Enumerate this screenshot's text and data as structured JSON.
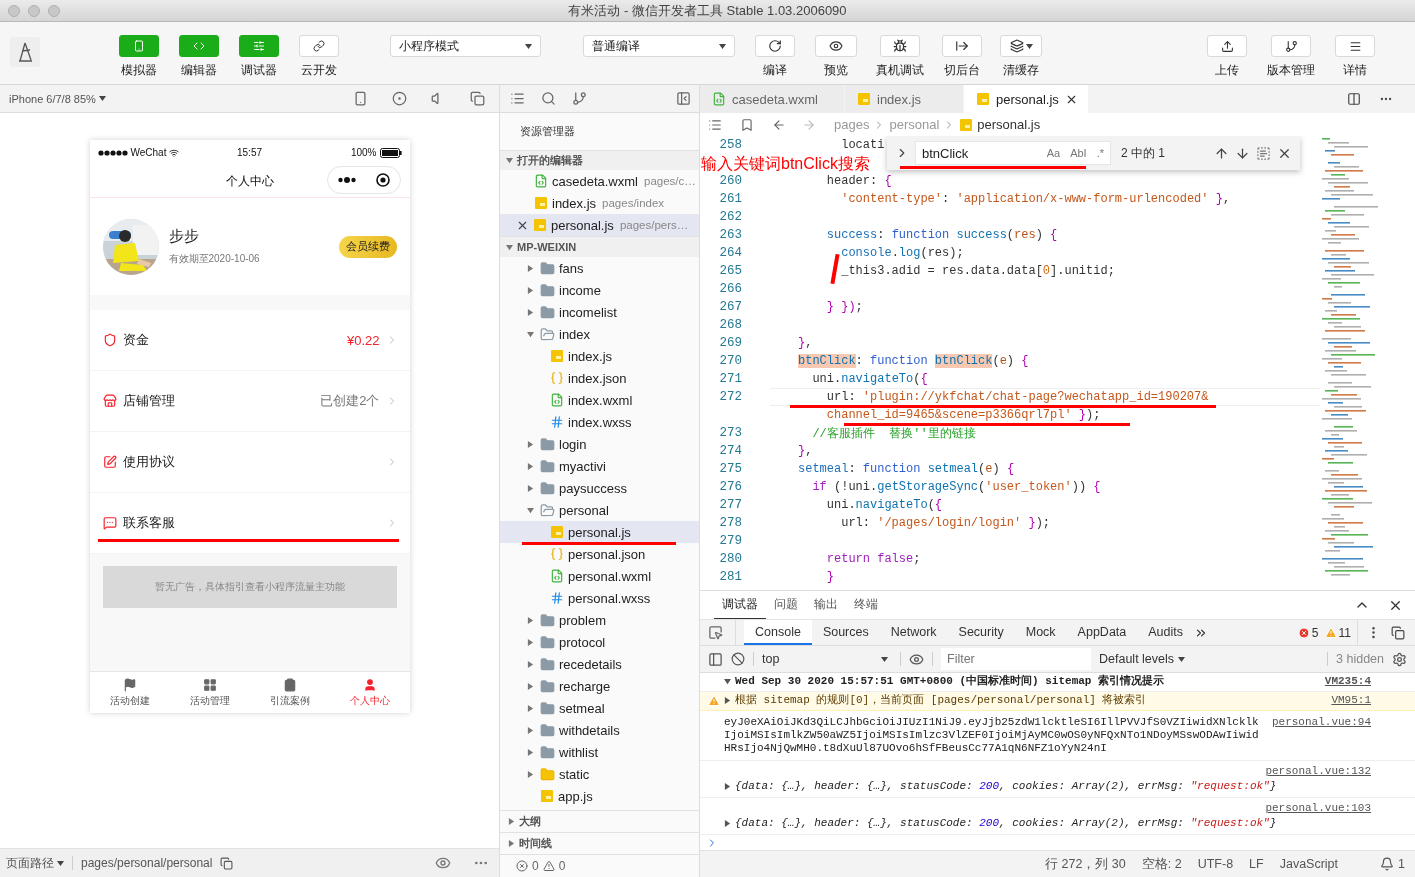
{
  "window": {
    "title": "有米活动 - 微信开发者工具 Stable 1.03.2006090"
  },
  "toolbar": {
    "view_buttons": [
      {
        "label": "模拟器",
        "on": true
      },
      {
        "label": "编辑器",
        "on": true
      },
      {
        "label": "调试器",
        "on": true
      },
      {
        "label": "云开发",
        "on": false
      }
    ],
    "mode_select": {
      "value": "小程序模式"
    },
    "compile_select": {
      "value": "普通编译"
    },
    "compile_buttons": [
      {
        "label": "编译"
      },
      {
        "label": "预览"
      }
    ],
    "tools": [
      {
        "label": "真机调试"
      },
      {
        "label": "切后台"
      },
      {
        "label": "清缓存"
      }
    ],
    "right_buttons": [
      {
        "label": "上传"
      },
      {
        "label": "版本管理"
      },
      {
        "label": "详情"
      }
    ]
  },
  "simulator": {
    "device": "iPhone 6/7/8 85%",
    "phone": {
      "carrier": "WeChat",
      "time": "15:57",
      "battery": "100%",
      "title": "个人中心",
      "user": {
        "name": "步步",
        "expiry": "有效期至2020-10-06",
        "badge": "会员续费"
      },
      "rows": [
        {
          "label": "资金",
          "value": "¥0.22",
          "emphasis": true,
          "marked": false
        },
        {
          "label": "店铺管理",
          "value": "已创建2个",
          "emphasis": false,
          "marked": false
        },
        {
          "label": "使用协议",
          "marked": false
        },
        {
          "label": "联系客服",
          "marked": true
        }
      ],
      "ad": "暂无广告，具体指引查看小程序流量主功能",
      "tabs": [
        {
          "label": "活动创建",
          "selected": false
        },
        {
          "label": "活动管理",
          "selected": false
        },
        {
          "label": "引流案例",
          "selected": false
        },
        {
          "label": "个人中心",
          "selected": true
        }
      ]
    },
    "footer": {
      "label": "页面路径",
      "path": "pages/personal/personal"
    }
  },
  "explorer": {
    "title": "资源管理器",
    "open_editors": {
      "title": "打开的编辑器",
      "expanded": true,
      "items": [
        {
          "name": "casedeta.wxml",
          "path": "pages/c…",
          "kind": "wxml",
          "selected": false
        },
        {
          "name": "index.js",
          "path": "pages/index",
          "kind": "js",
          "selected": false
        },
        {
          "name": "personal.js",
          "path": "pages/pers…",
          "kind": "js",
          "selected": true
        }
      ]
    },
    "project": {
      "title": "MP-WEIXIN",
      "expanded": true,
      "items": [
        {
          "name": "fans",
          "kind": "folder",
          "expanded": false
        },
        {
          "name": "income",
          "kind": "folder",
          "expanded": false
        },
        {
          "name": "incomelist",
          "kind": "folder",
          "expanded": false
        },
        {
          "name": "index",
          "kind": "folder",
          "expanded": true,
          "children": [
            {
              "name": "index.js",
              "kind": "js",
              "selected": false,
              "marked": false
            },
            {
              "name": "index.json",
              "kind": "json",
              "selected": false,
              "marked": false
            },
            {
              "name": "index.wxml",
              "kind": "wxml",
              "selected": false,
              "marked": false
            },
            {
              "name": "index.wxss",
              "kind": "wxss",
              "selected": false,
              "marked": false
            }
          ]
        },
        {
          "name": "login",
          "kind": "folder",
          "expanded": false
        },
        {
          "name": "myactivi",
          "kind": "folder",
          "expanded": false
        },
        {
          "name": "paysuccess",
          "kind": "folder",
          "expanded": false
        },
        {
          "name": "personal",
          "kind": "folder",
          "expanded": true,
          "children": [
            {
              "name": "personal.js",
              "kind": "js",
              "selected": true,
              "marked": true
            },
            {
              "name": "personal.json",
              "kind": "json",
              "selected": false,
              "marked": false
            },
            {
              "name": "personal.wxml",
              "kind": "wxml",
              "selected": false,
              "marked": false
            },
            {
              "name": "personal.wxss",
              "kind": "wxss",
              "selected": false,
              "marked": false
            }
          ]
        },
        {
          "name": "problem",
          "kind": "folder",
          "expanded": false
        },
        {
          "name": "protocol",
          "kind": "folder",
          "expanded": false
        },
        {
          "name": "recedetails",
          "kind": "folder",
          "expanded": false
        },
        {
          "name": "recharge",
          "kind": "folder",
          "expanded": false
        },
        {
          "name": "setmeal",
          "kind": "folder",
          "expanded": false
        },
        {
          "name": "withdetails",
          "kind": "folder",
          "expanded": false
        },
        {
          "name": "withlist",
          "kind": "folder",
          "expanded": false
        },
        {
          "name": "static",
          "kind": "static",
          "expanded": false
        },
        {
          "name": "app.js",
          "kind": "js",
          "selected": false,
          "marked": false
        }
      ]
    },
    "sections": [
      {
        "title": "大纲",
        "expanded": false
      },
      {
        "title": "时间线",
        "expanded": false
      }
    ],
    "problems": {
      "errors": "0",
      "warnings": "0"
    }
  },
  "editor": {
    "tabs": [
      {
        "name": "casedeta.wxml",
        "kind": "wxml",
        "selected": false
      },
      {
        "name": "index.js",
        "kind": "js",
        "selected": false
      },
      {
        "name": "personal.js",
        "kind": "js",
        "selected": true
      }
    ],
    "breadcrumb": [
      "pages",
      "personal",
      "personal.js"
    ],
    "annotation": "输入关键词btnClick搜索",
    "find": {
      "query": "btnClick",
      "marked": true,
      "options": [
        {
          "label": "Aa",
          "on": false
        },
        {
          "label": "AbI",
          "on": false
        },
        {
          "label": ".*",
          "on": false
        }
      ],
      "result": "2 中的 1"
    },
    "lines": [
      {
        "number": "258",
        "tokens": [
          {
            "kind": "plain",
            "text": "      locati"
          }
        ]
      },
      {
        "covered": true
      },
      {
        "number": "260",
        "tokens": [
          {
            "kind": "plain",
            "text": "    header: "
          },
          {
            "kind": "brace",
            "text": "{"
          }
        ]
      },
      {
        "number": "261",
        "tokens": [
          {
            "kind": "string",
            "text": "      'content-type'"
          },
          {
            "kind": "plain",
            "text": ": "
          },
          {
            "kind": "string",
            "text": "'application/x-www-form-urlencoded' "
          },
          {
            "kind": "brace",
            "text": "}"
          },
          {
            "kind": "plain",
            "text": ","
          }
        ]
      },
      {
        "number": "262"
      },
      {
        "number": "263",
        "tokens": [
          {
            "kind": "property",
            "text": "    success"
          },
          {
            "kind": "plain",
            "text": ": "
          },
          {
            "kind": "keyword",
            "text": "function "
          },
          {
            "kind": "function",
            "text": "success"
          },
          {
            "kind": "plain",
            "text": "("
          },
          {
            "kind": "param",
            "text": "res"
          },
          {
            "kind": "plain",
            "text": ") "
          },
          {
            "kind": "brace",
            "text": "{"
          }
        ]
      },
      {
        "number": "264",
        "tokens": [
          {
            "kind": "property",
            "text": "      console"
          },
          {
            "kind": "plain",
            "text": "."
          },
          {
            "kind": "function",
            "text": "log"
          },
          {
            "kind": "plain",
            "text": "(res);"
          }
        ]
      },
      {
        "number": "265",
        "strike": true,
        "tokens": [
          {
            "kind": "plain",
            "text": "      _this3.adid = res.data.data["
          },
          {
            "kind": "number",
            "text": "0"
          },
          {
            "kind": "plain",
            "text": "].unitid;"
          }
        ]
      },
      {
        "number": "266"
      },
      {
        "number": "267",
        "tokens": [
          {
            "kind": "brace",
            "text": "    } })"
          },
          {
            "kind": "plain",
            "text": ";"
          }
        ]
      },
      {
        "number": "268"
      },
      {
        "number": "269",
        "tokens": [
          {
            "kind": "brace",
            "text": "}"
          },
          {
            "kind": "plain",
            "text": ","
          }
        ]
      },
      {
        "number": "270",
        "tokens": [
          {
            "kind": "match",
            "text": "btnClick"
          },
          {
            "kind": "plain",
            "text": ": "
          },
          {
            "kind": "keyword",
            "text": "function "
          },
          {
            "kind": "match",
            "text": "btnClick"
          },
          {
            "kind": "plain",
            "text": "("
          },
          {
            "kind": "param",
            "text": "e"
          },
          {
            "kind": "plain",
            "text": ") "
          },
          {
            "kind": "brace",
            "text": "{"
          }
        ]
      },
      {
        "number": "271",
        "tokens": [
          {
            "kind": "plain",
            "text": "  uni."
          },
          {
            "kind": "function",
            "text": "navigateTo"
          },
          {
            "kind": "plain",
            "text": "("
          },
          {
            "kind": "brace",
            "text": "{"
          }
        ]
      },
      {
        "number": "272",
        "current": true,
        "marked": true,
        "tokens": [
          {
            "kind": "plain",
            "text": "    url: "
          },
          {
            "kind": "string",
            "text": "'plugin://ykfchat/chat-page?wechatapp_id=190207&"
          }
        ]
      },
      {
        "marked": true,
        "tokens": [
          {
            "kind": "string",
            "text": "    channel_id=9465&scene=p3366qrl7pl'"
          },
          {
            "kind": "brace",
            "text": " }"
          },
          {
            "kind": "plain",
            "text": ");"
          }
        ]
      },
      {
        "number": "273",
        "tokens": [
          {
            "kind": "comment",
            "text": "  //客服插件  替换''里的链接"
          }
        ]
      },
      {
        "number": "274",
        "tokens": [
          {
            "kind": "brace",
            "text": "}"
          },
          {
            "kind": "plain",
            "text": ","
          }
        ]
      },
      {
        "number": "275",
        "tokens": [
          {
            "kind": "property",
            "text": "setmeal"
          },
          {
            "kind": "plain",
            "text": ": "
          },
          {
            "kind": "keyword",
            "text": "function "
          },
          {
            "kind": "function",
            "text": "setmeal"
          },
          {
            "kind": "plain",
            "text": "("
          },
          {
            "kind": "param",
            "text": "e"
          },
          {
            "kind": "plain",
            "text": ") "
          },
          {
            "kind": "brace",
            "text": "{"
          }
        ]
      },
      {
        "number": "276",
        "tokens": [
          {
            "kind": "control",
            "text": "  if"
          },
          {
            "kind": "plain",
            "text": " (!uni."
          },
          {
            "kind": "function",
            "text": "getStorageSync"
          },
          {
            "kind": "plain",
            "text": "("
          },
          {
            "kind": "string",
            "text": "'user_token'"
          },
          {
            "kind": "plain",
            "text": ")) "
          },
          {
            "kind": "brace",
            "text": "{"
          }
        ]
      },
      {
        "number": "277",
        "tokens": [
          {
            "kind": "plain",
            "text": "    uni."
          },
          {
            "kind": "function",
            "text": "navigateTo"
          },
          {
            "kind": "plain",
            "text": "("
          },
          {
            "kind": "brace",
            "text": "{"
          }
        ]
      },
      {
        "number": "278",
        "tokens": [
          {
            "kind": "plain",
            "text": "      url: "
          },
          {
            "kind": "string",
            "text": "'/pages/login/login' "
          },
          {
            "kind": "brace",
            "text": "}"
          },
          {
            "kind": "plain",
            "text": ");"
          }
        ]
      },
      {
        "number": "279"
      },
      {
        "number": "280",
        "tokens": [
          {
            "kind": "control",
            "text": "    return false"
          },
          {
            "kind": "plain",
            "text": ";"
          }
        ]
      },
      {
        "number": "281",
        "tokens": [
          {
            "kind": "brace",
            "text": "    }"
          }
        ]
      }
    ]
  },
  "console": {
    "panel_tabs": [
      {
        "label": "调试器",
        "selected": true
      },
      {
        "label": "问题",
        "selected": false
      },
      {
        "label": "输出",
        "selected": false
      },
      {
        "label": "终端",
        "selected": false
      }
    ],
    "devtools_tabs": [
      {
        "label": "Console",
        "selected": true
      },
      {
        "label": "Sources",
        "selected": false
      },
      {
        "label": "Network",
        "selected": false
      },
      {
        "label": "Security",
        "selected": false
      },
      {
        "label": "Mock",
        "selected": false
      },
      {
        "label": "AppData",
        "selected": false
      },
      {
        "label": "Audits",
        "selected": false
      }
    ],
    "errors": "5",
    "warnings": "11",
    "context": "top",
    "filter_placeholder": "Filter",
    "levels": "Default levels",
    "hidden": "3 hidden",
    "messages": [
      {
        "kind": "group",
        "text": "Wed Sep 30 2020 15:57:51 GMT+0800 (中国标准时间) sitemap 索引情况提示",
        "source": "VM235:4"
      },
      {
        "kind": "warning",
        "text": "根据 sitemap 的规则[0]，当前页面 [pages/personal/personal] 将被索引",
        "source": "VM95:1"
      },
      {
        "kind": "log",
        "text": "eyJ0eXAiOiJKd3QiLCJhbGciOiJIUzI1NiJ9.eyJjb25zdW1lcktleSI6IllPVVJfS0VZIiwidXNlcklkIjoiMSIsImlkZW50aWZ5IjoiMSIsImlzc3VlZEF0IjoiMjAyMC0wOS0yNFQxNTo1NDoyMSswODAwIiwidHRsIjo4NjQwMH0.t8dXuUl87UOvo6hSfFBeusCc77A1qN6NFZ1oYyN24nI",
        "source": "personal.vue:94"
      },
      {
        "kind": "object",
        "source": "personal.vue:132",
        "tokens": [
          {
            "kind": "plain",
            "text": "{data: {…}, header: {…}, statusCode: "
          },
          {
            "kind": "number",
            "text": "200"
          },
          {
            "kind": "plain",
            "text": ", cookies: Array(2), errMsg: "
          },
          {
            "kind": "string",
            "text": "\"request:ok\""
          },
          {
            "kind": "plain",
            "text": "}"
          }
        ]
      },
      {
        "kind": "object",
        "source": "personal.vue:103",
        "tokens": [
          {
            "kind": "plain",
            "text": "{data: {…}, header: {…}, statusCode: "
          },
          {
            "kind": "number",
            "text": "200"
          },
          {
            "kind": "plain",
            "text": ", cookies: Array(2), errMsg: "
          },
          {
            "kind": "string",
            "text": "\"request:ok\""
          },
          {
            "kind": "plain",
            "text": "}"
          }
        ]
      }
    ]
  },
  "status_bar": {
    "items": [
      "行 272，列 30",
      "空格: 2",
      "UTF-8",
      "LF",
      "JavaScript"
    ],
    "notifications": "1"
  }
}
